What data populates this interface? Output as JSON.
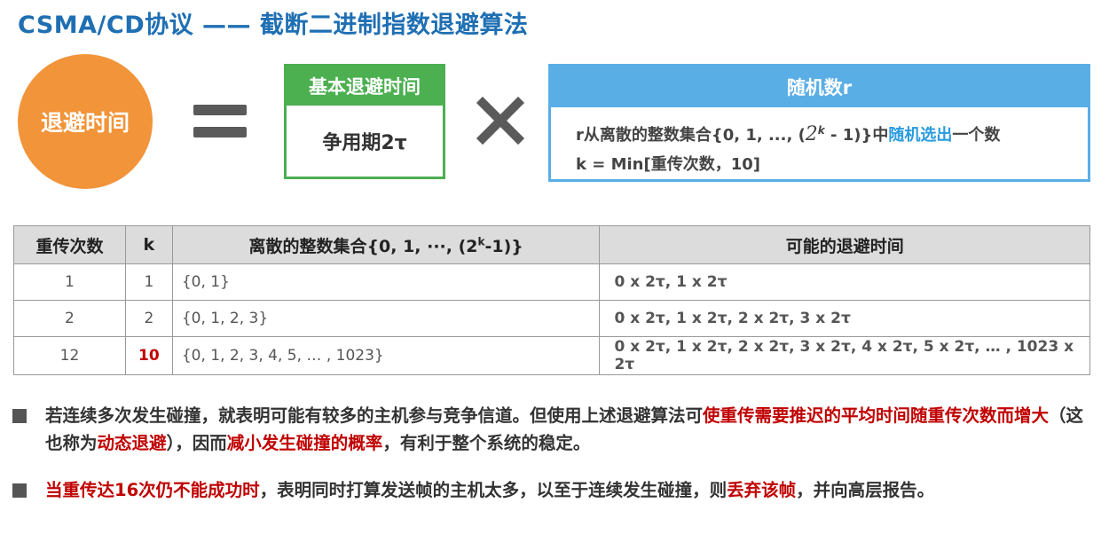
{
  "title": "CSMA/CD协议 —— 截断二进制指数退避算法",
  "formula": {
    "left_label": "退避时间",
    "basic": {
      "head": "基本退避时间",
      "body": "争用期2τ"
    },
    "random": {
      "head": "随机数r",
      "line1_a": "r从离散的整数集合{0, 1, ..., (",
      "line1_base": "2",
      "line1_exp": "k",
      "line1_b": " - 1)}中",
      "line1_hl": "随机选出",
      "line1_c": "一个数",
      "line2": "k = Min[重传次数，10]"
    }
  },
  "table": {
    "headers": [
      "重传次数",
      "k",
      "离散的整数集合{0, 1, ···, (2",
      "k",
      "-1)}",
      "可能的退避时间"
    ],
    "rows": [
      {
        "n": "1",
        "k": "1",
        "set": "{0, 1}",
        "times": "0 x 2τ,  1 x 2τ"
      },
      {
        "n": "2",
        "k": "2",
        "set": "{0, 1, 2, 3}",
        "times": "0 x 2τ,  1 x 2τ, 2 x 2τ, 3 x 2τ"
      },
      {
        "n": "12",
        "k": "10",
        "set": "{0, 1, 2, 3, 4, 5,  … , 1023}",
        "times": "0 x 2τ,  1 x 2τ, 2 x 2τ, 3 x 2τ, 4 x 2τ, 5 x 2τ, … , 1023 x 2τ"
      }
    ]
  },
  "bullets": {
    "b1": {
      "p1": "若连续多次发生碰撞，就表明可能有较多的主机参与竞争信道。但使用上述退避算法可",
      "r1": "使重传需要推迟的平均时间随重传次数而增大",
      "p2": "（这也称为",
      "r2": "动态退避",
      "p3": "），因而",
      "r3": "减小发生碰撞的概率",
      "p4": "，有利于整个系统的稳定。"
    },
    "b2": {
      "r1": "当重传达16次仍不能成功时",
      "p1": "，表明同时打算发送帧的主机太多，以至于连续发生碰撞，则",
      "r2": "丢弃该帧",
      "p2": "，并向高层报告。"
    }
  },
  "colors": {
    "title": "#1f6fb3",
    "orange": "#f2943a",
    "green": "#4caf50",
    "blue": "#5aaee6",
    "red": "#c00000"
  }
}
